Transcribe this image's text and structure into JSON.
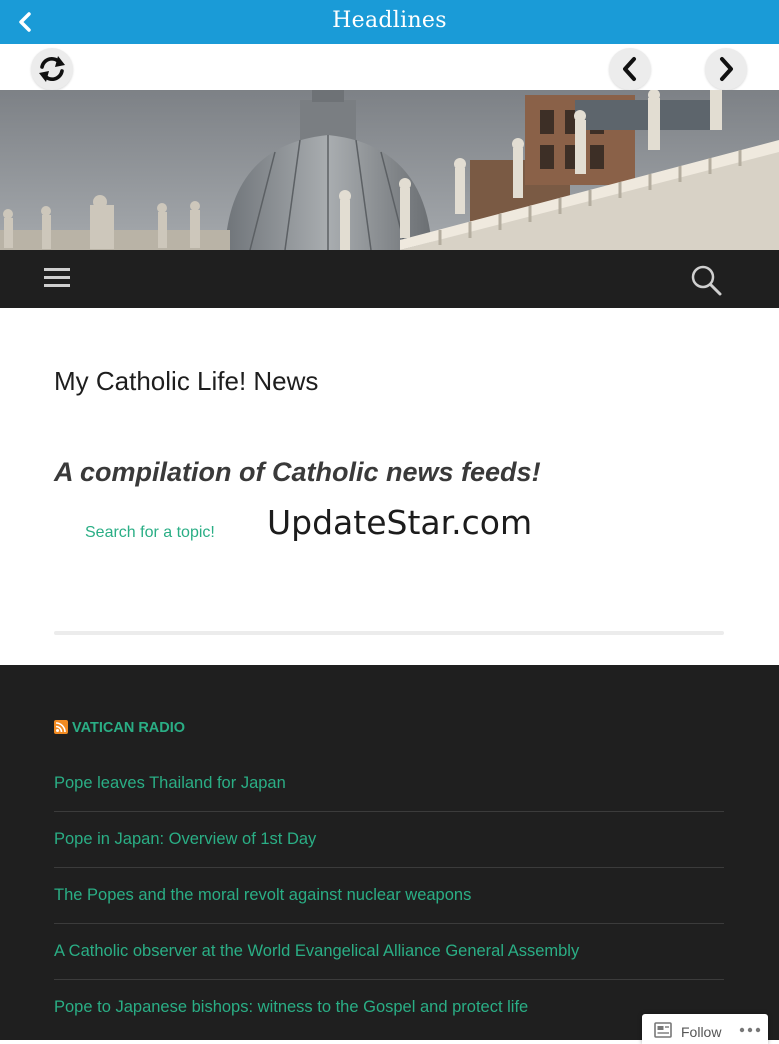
{
  "app_bar": {
    "title": "Headlines",
    "back_icon": "chevron-left-icon",
    "color": "#1a9bd7"
  },
  "nav_controls": {
    "refresh_icon": "refresh-icon",
    "prev_icon": "chevron-left-icon",
    "next_icon": "chevron-right-icon"
  },
  "header": {
    "menu_icon": "hamburger-menu-icon",
    "search_icon": "search-icon"
  },
  "site": {
    "title": "My Catholic Life! News",
    "tagline": "A compilation of Catholic news feeds!",
    "search_topic_link": "Search for a topic!",
    "brand_text": "UpdateStar.com"
  },
  "widget": {
    "icon": "rss-icon",
    "title": "VATICAN RADIO",
    "items": [
      "Pope leaves Thailand for Japan",
      "Pope in Japan: Overview of 1st Day",
      "The Popes and the moral revolt against nuclear weapons",
      "A Catholic observer at the World Evangelical Alliance General Assembly",
      "Pope to Japanese bishops: witness to the Gospel and protect life"
    ]
  },
  "follow_widget": {
    "label": "Follow",
    "icon": "follow-reader-icon",
    "more_icon": "more-dots-icon"
  },
  "colors": {
    "accent": "#2aae85",
    "dark_bg": "#1f1f1f"
  }
}
